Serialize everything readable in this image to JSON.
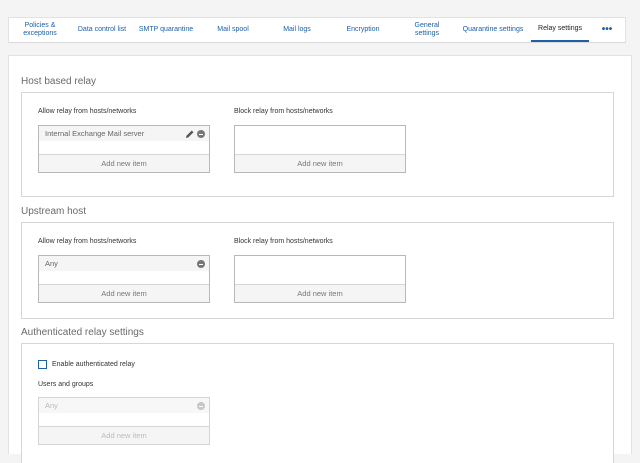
{
  "tabs": [
    {
      "label": "Policies & exceptions"
    },
    {
      "label": "Data control list"
    },
    {
      "label": "SMTP quarantine"
    },
    {
      "label": "Mail spool"
    },
    {
      "label": "Mail logs"
    },
    {
      "label": "Encryption"
    },
    {
      "label": "General settings"
    },
    {
      "label": "Quarantine settings"
    },
    {
      "label": "Relay settings",
      "active": true
    },
    {
      "label": "•••"
    }
  ],
  "host_based_relay": {
    "title": "Host based relay",
    "allow_label": "Allow relay from hosts/networks",
    "block_label": "Block relay from hosts/networks",
    "allow_items": [
      "Internal Exchange Mail server"
    ],
    "add_new": "Add new item"
  },
  "upstream_host": {
    "title": "Upstream host",
    "allow_label": "Allow relay from hosts/networks",
    "block_label": "Block relay from hosts/networks",
    "allow_items": [
      "Any"
    ],
    "add_new": "Add new item"
  },
  "authenticated_relay": {
    "title": "Authenticated relay settings",
    "enable_label": "Enable authenticated relay",
    "enabled": false,
    "users_label": "Users and groups",
    "users_items": [
      "Any"
    ],
    "add_new": "Add new item"
  },
  "colors": {
    "accent": "#1d5fa8",
    "panel_border": "#d6d6d6"
  }
}
